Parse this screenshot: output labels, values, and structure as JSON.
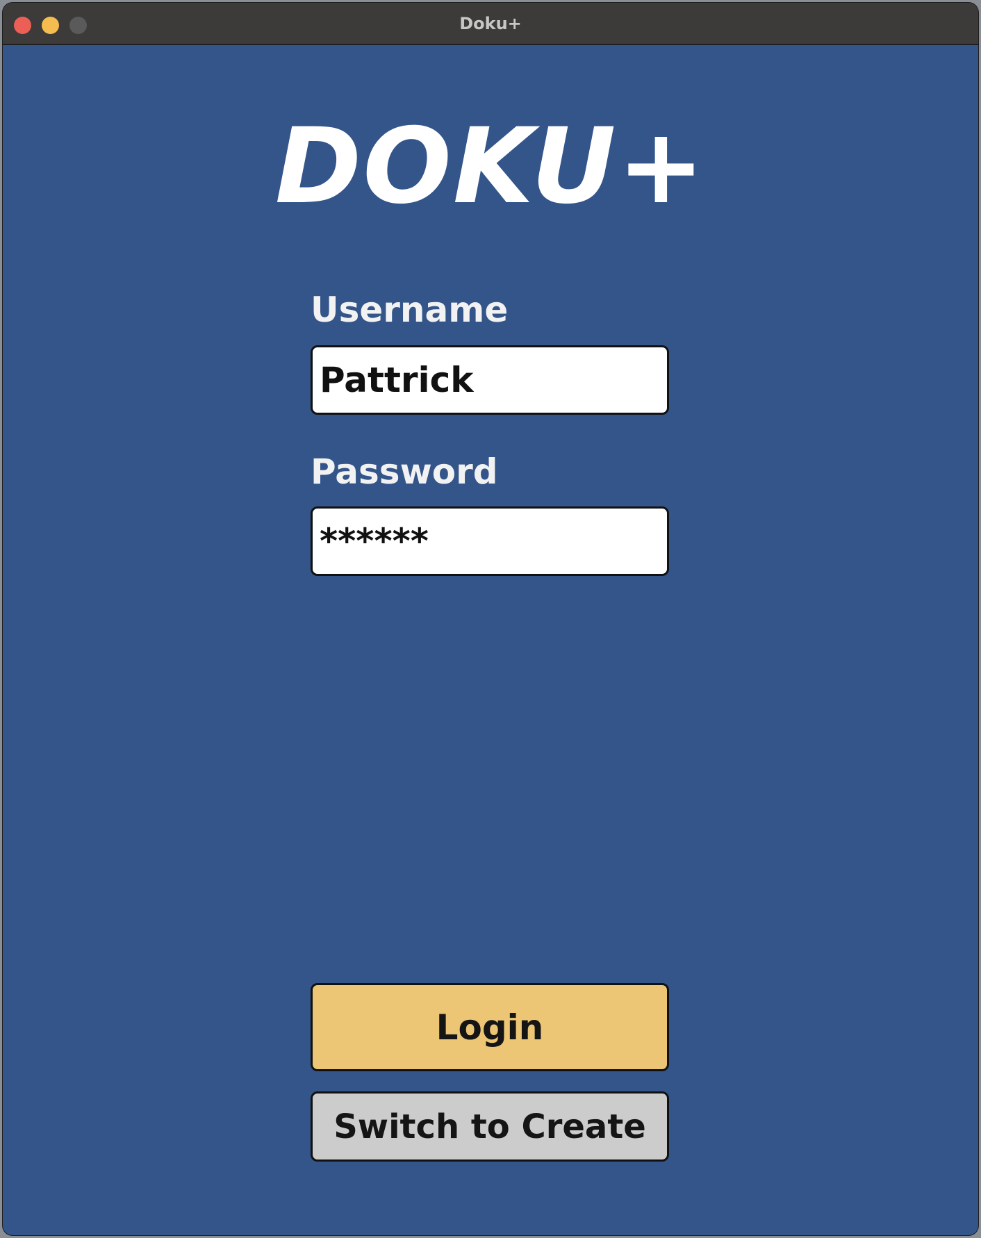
{
  "window": {
    "title": "Doku+",
    "controls": {
      "close_color": "#ec5f57",
      "minimize_color": "#f5bd4f",
      "maximize_color": "#5a5a5a"
    }
  },
  "app": {
    "logo": "DOKU+",
    "background_color": "#33558a"
  },
  "form": {
    "username": {
      "label": "Username",
      "value": "Pattrick"
    },
    "password": {
      "label": "Password",
      "value": "******"
    }
  },
  "actions": {
    "login_label": "Login",
    "login_color": "#ecc674",
    "switch_label": "Switch to Create",
    "switch_color": "#cccccc"
  }
}
